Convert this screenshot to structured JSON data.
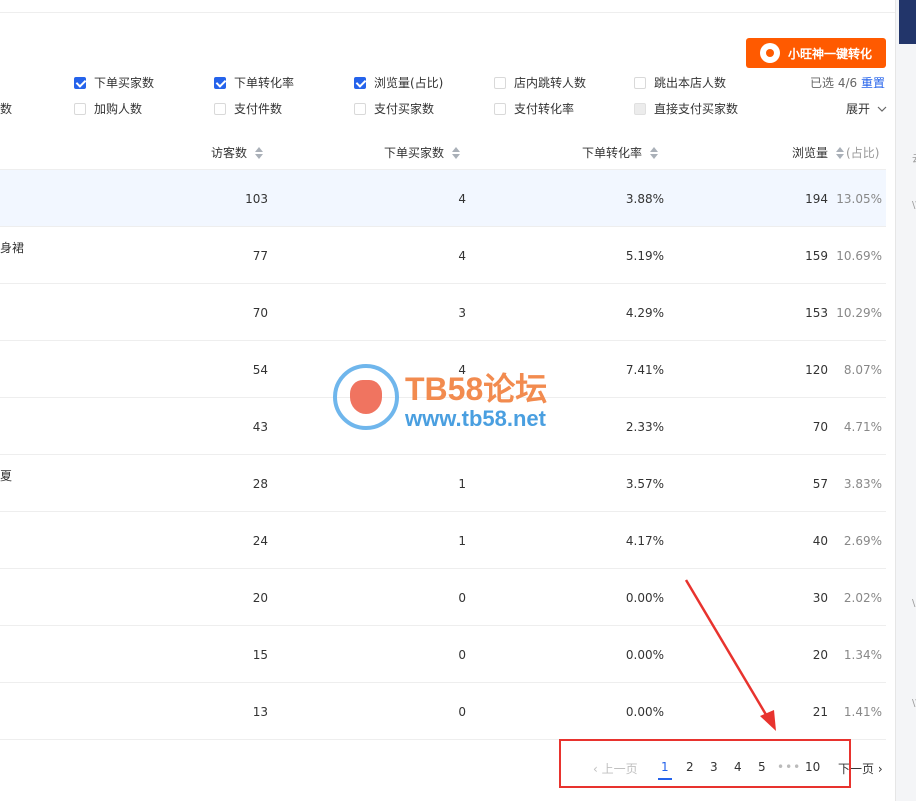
{
  "brand_button": {
    "label": "小旺神一键转化"
  },
  "metrics": {
    "row1": [
      {
        "label": "下单买家数",
        "checked": true
      },
      {
        "label": "下单转化率",
        "checked": true
      },
      {
        "label": "浏览量(占比)",
        "checked": true
      },
      {
        "label": "店内跳转人数",
        "checked": false
      },
      {
        "label": "跳出本店人数",
        "checked": false
      }
    ],
    "row2": [
      {
        "label": "加购人数",
        "checked": false
      },
      {
        "label": "支付件数",
        "checked": false
      },
      {
        "label": "支付买家数",
        "checked": false
      },
      {
        "label": "支付转化率",
        "checked": false
      },
      {
        "label": "直接支付买家数",
        "checked": false,
        "disabled": true
      }
    ],
    "row2_cut_prefix": "数",
    "selected_info": "已选 4/6",
    "reset_label": "重置",
    "expand_label": "展开"
  },
  "table": {
    "columns": [
      "访客数",
      "下单买家数",
      "下单转化率",
      "浏览量",
      "(占比)"
    ],
    "rows": [
      {
        "product_fragment": "",
        "visitors": "103",
        "buyers": "4",
        "rate": "3.88%",
        "views": "194",
        "share": "13.05%"
      },
      {
        "product_fragment": "身裙",
        "visitors": "77",
        "buyers": "4",
        "rate": "5.19%",
        "views": "159",
        "share": "10.69%"
      },
      {
        "product_fragment": "",
        "visitors": "70",
        "buyers": "3",
        "rate": "4.29%",
        "views": "153",
        "share": "10.29%"
      },
      {
        "product_fragment": "",
        "visitors": "54",
        "buyers": "4",
        "rate": "7.41%",
        "views": "120",
        "share": "8.07%"
      },
      {
        "product_fragment": "",
        "visitors": "43",
        "buyers": "",
        "rate": "2.33%",
        "views": "70",
        "share": "4.71%"
      },
      {
        "product_fragment": "夏",
        "visitors": "28",
        "buyers": "1",
        "rate": "3.57%",
        "views": "57",
        "share": "3.83%"
      },
      {
        "product_fragment": "",
        "visitors": "24",
        "buyers": "1",
        "rate": "4.17%",
        "views": "40",
        "share": "2.69%"
      },
      {
        "product_fragment": "",
        "visitors": "20",
        "buyers": "0",
        "rate": "0.00%",
        "views": "30",
        "share": "2.02%"
      },
      {
        "product_fragment": "",
        "visitors": "15",
        "buyers": "0",
        "rate": "0.00%",
        "views": "20",
        "share": "1.34%"
      },
      {
        "product_fragment": "",
        "visitors": "13",
        "buyers": "0",
        "rate": "0.00%",
        "views": "21",
        "share": "1.41%"
      }
    ]
  },
  "pagination": {
    "prev_label": "上一页",
    "pages": [
      "1",
      "2",
      "3",
      "4",
      "5"
    ],
    "ellipsis": "•••",
    "last_page": "10",
    "next_label": "下一页",
    "current": "1"
  },
  "watermark": {
    "title": "TB58论坛",
    "url": "www.tb58.net"
  },
  "colors": {
    "accent": "#2563eb",
    "brand_orange": "#ff5a00",
    "annotation_red": "#e8332e"
  }
}
